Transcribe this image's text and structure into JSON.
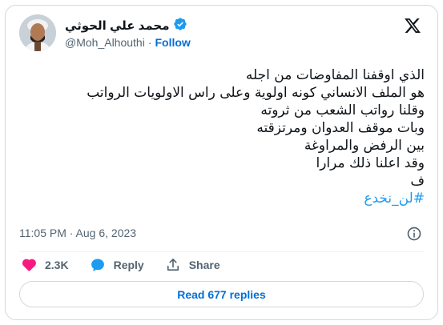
{
  "author": {
    "display_name": "محمد علي الحوثي",
    "handle": "@Moh_Alhouthi",
    "separator": "·",
    "follow_label": "Follow",
    "verified": true
  },
  "tweet": {
    "lines": [
      "الذي اوقفنا المفاوضات من اجله",
      "هو الملف الانساني كونه اولوية وعلى راس الاولويات الرواتب",
      "وقلنا رواتب الشعب من ثروته",
      "وبات موقف  العدوان ومرتزقته",
      "بين الرفض والمراوغة",
      "وقد اعلنا ذلك مرارا",
      "ف"
    ],
    "hashtag": "#لن_نخدع"
  },
  "meta": {
    "timestamp": "11:05 PM · Aug 6, 2023"
  },
  "actions": {
    "likes": "2.3K",
    "reply_label": "Reply",
    "share_label": "Share"
  },
  "read_replies_label": "Read 677 replies",
  "colors": {
    "like": "#f91880",
    "reply": "#1d9bf0",
    "link": "#006fd6",
    "verified": "#1d9bf0",
    "muted": "#536471"
  },
  "icons": [
    "verified-badge-icon",
    "x-logo-icon",
    "info-icon",
    "heart-icon",
    "reply-bubble-icon",
    "share-icon"
  ]
}
